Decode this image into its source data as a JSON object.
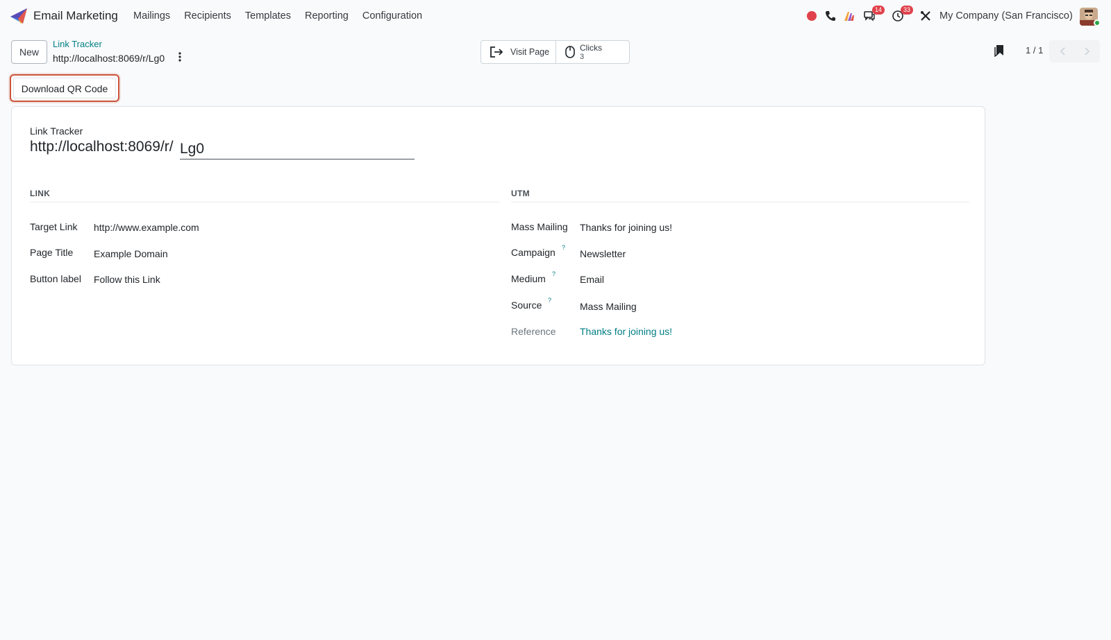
{
  "navbar": {
    "app_name": "Email Marketing",
    "menu": [
      "Mailings",
      "Recipients",
      "Templates",
      "Reporting",
      "Configuration"
    ],
    "messages_badge": "14",
    "activities_badge": "33",
    "company": "My Company (San Francisco)",
    "brand_color": "#7c4dbb"
  },
  "control": {
    "new_label": "New",
    "breadcrumb": "Link Tracker",
    "record_title": "http://localhost:8069/r/Lg0",
    "visit_label": "Visit Page",
    "clicks_label": "Clicks",
    "clicks_value": "3",
    "pager": "1 / 1"
  },
  "actions": {
    "download_qr": "Download QR Code"
  },
  "form": {
    "title_label": "Link Tracker",
    "title_prefix": "http://localhost:8069/r/",
    "code_value": "Lg0",
    "link_section": {
      "title": "LINK",
      "fields": [
        {
          "label": "Target Link",
          "value": "http://www.example.com"
        },
        {
          "label": "Page Title",
          "value": "Example Domain"
        },
        {
          "label": "Button label",
          "value": "Follow this Link"
        }
      ]
    },
    "utm_section": {
      "title": "UTM",
      "fields": [
        {
          "label": "Mass Mailing",
          "value": "Thanks for joining us!",
          "help": ""
        },
        {
          "label": "Campaign",
          "value": "Newsletter",
          "help": "?"
        },
        {
          "label": "Medium",
          "value": "Email",
          "help": "?"
        },
        {
          "label": "Source",
          "value": "Mass Mailing",
          "help": "?"
        },
        {
          "label": "Reference",
          "value": "Thanks for joining us!",
          "help": ""
        }
      ]
    }
  },
  "colors": {
    "accent": "#017e84",
    "highlight": "#c9553a",
    "badge": "#e0424b",
    "record": "#e0424b"
  }
}
